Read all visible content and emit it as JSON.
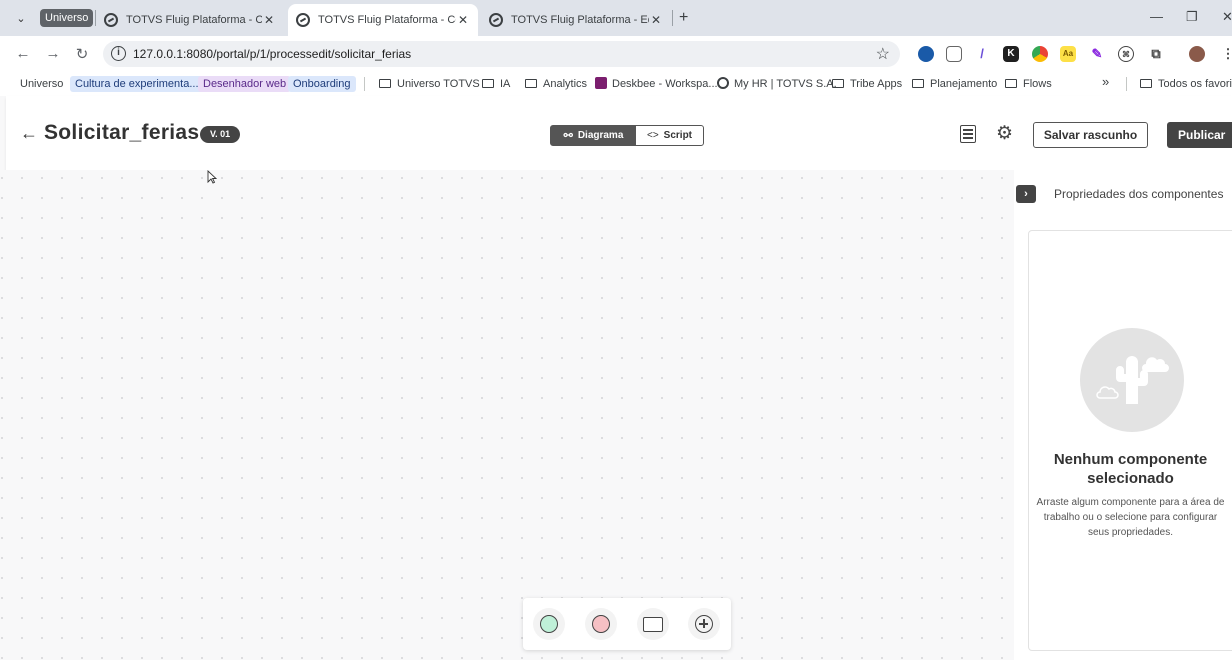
{
  "browser": {
    "tab_group_label": "Universo",
    "tabs": [
      {
        "title": "TOTVS Fluig Plataforma - Config"
      },
      {
        "title": "TOTVS Fluig Plataforma - Config"
      },
      {
        "title": "TOTVS Fluig Plataforma - Edição"
      }
    ],
    "address": "127.0.0.1:8080/portal/p/1/processedit/solicitar_ferias",
    "bookmarks": {
      "universo": "Universo",
      "cultura": "Cultura de experimenta...",
      "desenhador": "Desenhador web",
      "onboarding": "Onboarding",
      "universo_totvs": "Universo TOTVS",
      "ia": "IA",
      "analytics": "Analytics",
      "deskbee": "Deskbee - Workspa...",
      "myhr": "My HR | TOTVS S.A.",
      "tribe": "Tribe Apps",
      "planejamento": "Planejamento",
      "flows": "Flows",
      "more": "»",
      "all": "Todos os favoritos"
    }
  },
  "header": {
    "title": "Solicitar_ferias",
    "version": "V. 01",
    "mode_diagram": "Diagrama",
    "mode_script": "Script",
    "save_draft": "Salvar rascunho",
    "publish": "Publicar"
  },
  "panel": {
    "title": "Propriedades dos componentes",
    "empty_title": "Nenhum componente selecionado",
    "empty_desc": "Arraste algum componente para a área de trabalho ou o selecione para configurar seus propriedades."
  },
  "palette": [
    "start-event",
    "end-event",
    "task",
    "gateway"
  ],
  "colors": {
    "start_event": "#bff0d8",
    "end_event": "#f6c0c4",
    "accent_dark": "#444444"
  }
}
